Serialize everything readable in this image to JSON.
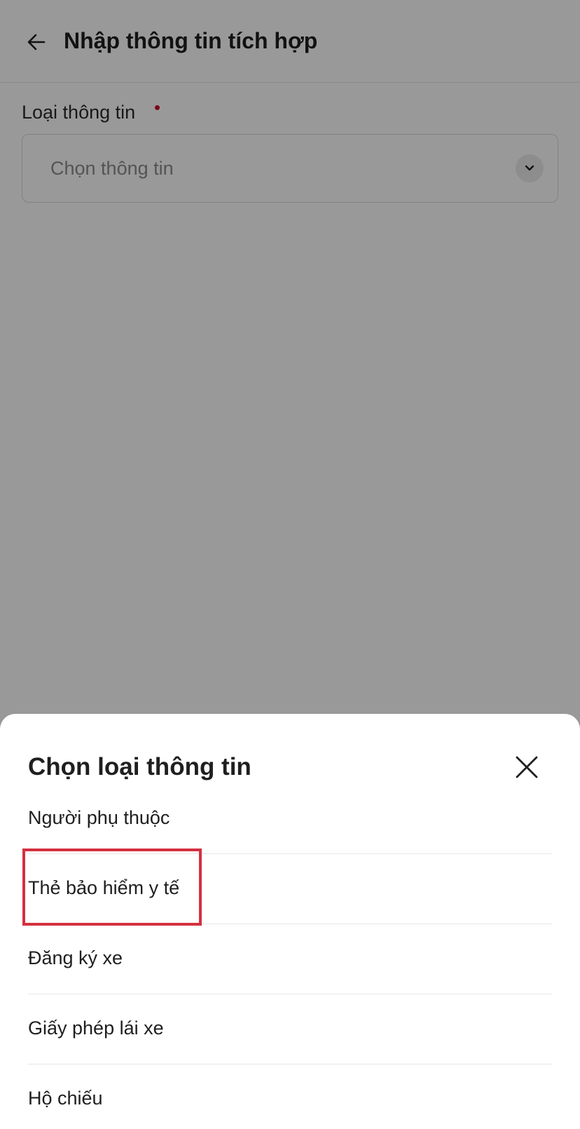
{
  "header": {
    "title": "Nhập thông tin tích hợp",
    "back_icon": "arrow-left-icon"
  },
  "form": {
    "field_label": "Loại thông tin",
    "required": true,
    "select_placeholder": "Chọn thông tin",
    "select_icon": "chevron-down-icon"
  },
  "sheet": {
    "title": "Chọn loại thông tin",
    "close_icon": "close-icon",
    "options": [
      {
        "label": "Người phụ thuộc"
      },
      {
        "label": "Thẻ bảo hiểm y tế",
        "highlighted": true
      },
      {
        "label": "Đăng ký xe"
      },
      {
        "label": "Giấy phép lái xe"
      },
      {
        "label": "Hộ chiếu"
      }
    ]
  },
  "colors": {
    "required_dot": "#c8102e",
    "highlight_border": "#d4303f",
    "overlay": "rgba(0,0,0,0.40)"
  }
}
